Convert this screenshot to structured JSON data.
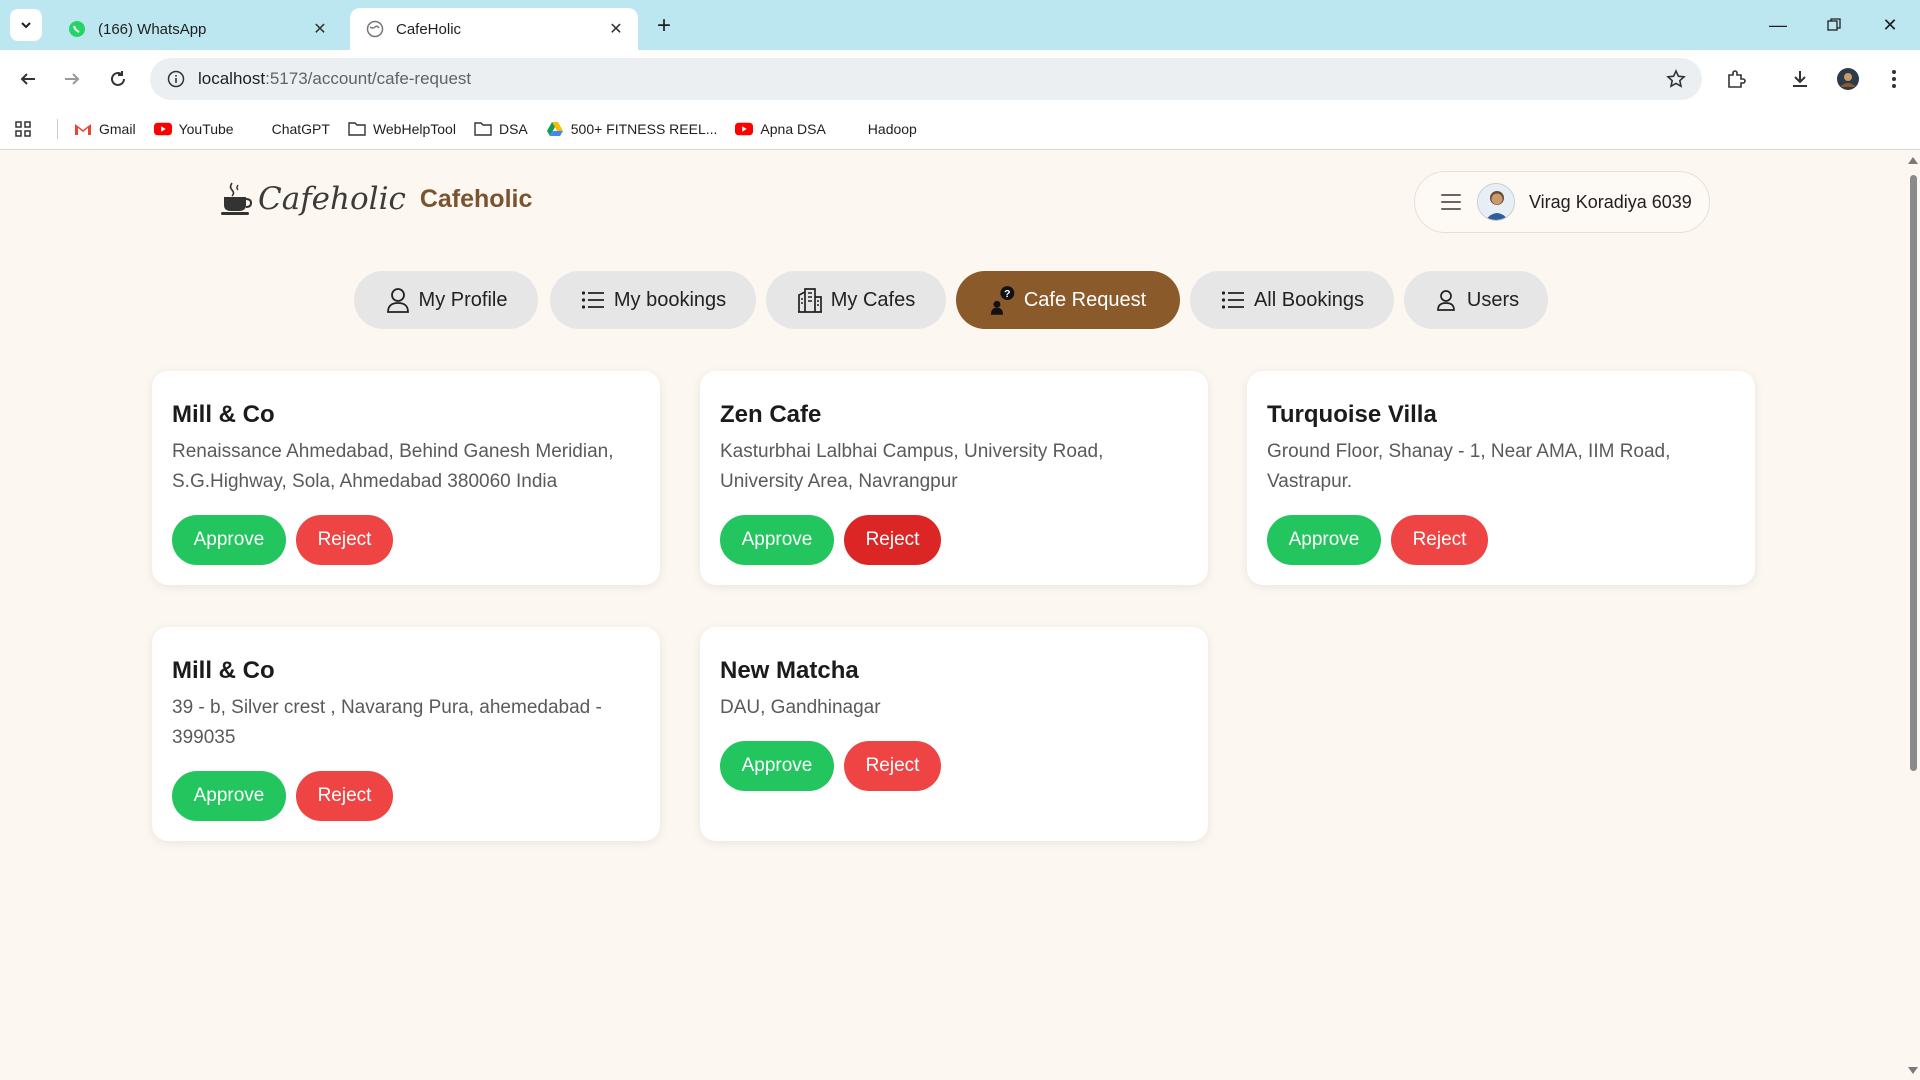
{
  "browser": {
    "tabs": [
      {
        "title": "(166) WhatsApp",
        "active": false
      },
      {
        "title": "CafeHolic",
        "active": true
      }
    ],
    "url_host": "localhost",
    "url_path": ":5173/account/cafe-request",
    "bookmarks": [
      "Gmail",
      "YouTube",
      "ChatGPT",
      "WebHelpTool",
      "DSA",
      "500+ FITNESS REEL...",
      "Apna DSA",
      "Hadoop"
    ]
  },
  "header": {
    "brand_script": "Cafeholic",
    "brand_name": "Cafeholic",
    "user_name": "Virag Koradiya 6039"
  },
  "nav": {
    "items": [
      {
        "label": "My Profile",
        "icon": "user-icon",
        "active": false
      },
      {
        "label": "My bookings",
        "icon": "list-icon",
        "active": false
      },
      {
        "label": "My Cafes",
        "icon": "building-icon",
        "active": false
      },
      {
        "label": "Cafe Request",
        "icon": "user-question-icon",
        "active": true
      },
      {
        "label": "All Bookings",
        "icon": "list-icon",
        "active": false
      },
      {
        "label": "Users",
        "icon": "user-icon",
        "active": false
      }
    ]
  },
  "requests": [
    {
      "name": "Mill & Co",
      "address": "Renaissance Ahmedabad, Behind Ganesh Meridian, S.G.Highway, Sola, Ahmedabad 380060 India"
    },
    {
      "name": "Zen Cafe",
      "address": "Kasturbhai Lalbhai Campus, University Road, University Area, Navrangpur"
    },
    {
      "name": "Turquoise Villa",
      "address": "Ground Floor, Shanay - 1, Near AMA, IIM Road, Vastrapur."
    },
    {
      "name": "Mill & Co",
      "address": "39 - b, Silver crest , Navarang Pura, ahemedabad - 399035"
    },
    {
      "name": "New Matcha",
      "address": "DAU, Gandhinagar"
    }
  ],
  "actions": {
    "approve": "Approve",
    "reject": "Reject"
  },
  "colors": {
    "accent": "#8b5a2b",
    "approve": "#22c55e",
    "reject": "#ef4444",
    "background": "#fdf7f2"
  }
}
